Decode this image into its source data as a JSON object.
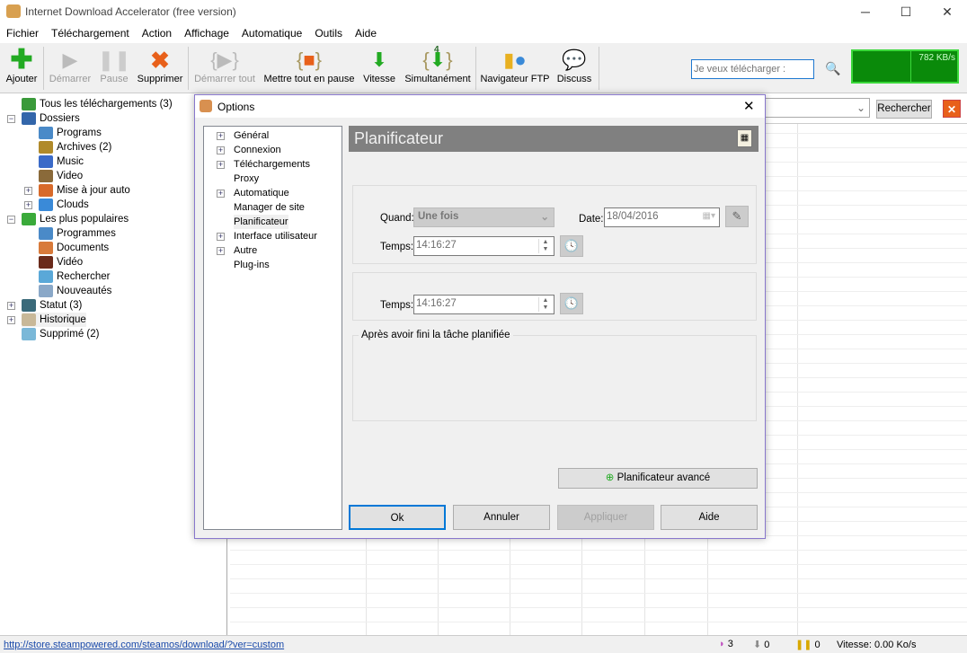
{
  "window": {
    "title": "Internet Download Accelerator (free version)",
    "minimize": "─",
    "maximize": "☐",
    "close": "✕"
  },
  "menu": [
    "Fichier",
    "Téléchargement",
    "Action",
    "Affichage",
    "Automatique",
    "Outils",
    "Aide"
  ],
  "toolbar": {
    "buttons": [
      {
        "label": "Ajouter",
        "icon": "add-icon",
        "enabled": true
      },
      {
        "label": "Démarrer",
        "icon": "play-icon",
        "enabled": false
      },
      {
        "label": "Pause",
        "icon": "pause-icon",
        "enabled": false
      },
      {
        "label": "Supprimer",
        "icon": "delete-icon",
        "enabled": true
      },
      {
        "label": "Démarrer tout",
        "icon": "start-all-icon",
        "enabled": false
      },
      {
        "label": "Mettre tout en pause",
        "icon": "pause-all-icon",
        "enabled": true
      },
      {
        "label": "Vitesse",
        "icon": "speed-icon",
        "enabled": true
      },
      {
        "label": "Simultanément",
        "icon": "simultaneous-icon",
        "enabled": true,
        "badge": "4"
      },
      {
        "label": "Navigateur FTP",
        "icon": "ftp-icon",
        "enabled": true
      },
      {
        "label": "Discuss",
        "icon": "chat-icon",
        "enabled": true
      }
    ],
    "search_placeholder": "Je veux télécharger :",
    "speed_graph": "782 KB/s"
  },
  "tree": [
    {
      "label": "Tous les téléchargements (3)",
      "color": "#3a9a3a"
    },
    {
      "label": "Dossiers",
      "color": "#3366aa"
    },
    {
      "label": "Programs",
      "color": "#4a8ac8"
    },
    {
      "label": "Archives (2)",
      "color": "#b08a2a"
    },
    {
      "label": "Music",
      "color": "#3a6ac8"
    },
    {
      "label": "Video",
      "color": "#8a6a3a"
    },
    {
      "label": "Mise à jour auto",
      "color": "#d86a2a"
    },
    {
      "label": "Clouds",
      "color": "#3a8ad8"
    },
    {
      "label": "Les plus populaires",
      "color": "#3aaa3a"
    },
    {
      "label": "Programmes",
      "color": "#4a8ac8"
    },
    {
      "label": "Documents",
      "color": "#d87a3a"
    },
    {
      "label": "Vidéo",
      "color": "#6a2a1a"
    },
    {
      "label": "Rechercher",
      "color": "#5aa8d8"
    },
    {
      "label": "Nouveautés",
      "color": "#8aa8c8"
    },
    {
      "label": "Statut (3)",
      "color": "#3a6a7a"
    },
    {
      "label": "Historique",
      "color": "#c8b898"
    },
    {
      "label": "Supprimé (2)",
      "color": "#7ab8d8"
    }
  ],
  "main": {
    "search_button": "Rechercher"
  },
  "dialog": {
    "title": "Options",
    "close": "✕",
    "nav": [
      "Général",
      "Connexion",
      "Téléchargements",
      "Proxy",
      "Automatique",
      "Manager de site",
      "Planificateur",
      "Interface utilisateur",
      "Autre",
      "Plug-ins"
    ],
    "header": "Planificateur",
    "quand_label": "Quand:",
    "quand_value": "Une fois",
    "date_label": "Date:",
    "date_value": "18/04/2016",
    "temps_label": "Temps:",
    "temps_value1": "14:16:27",
    "temps_value2": "14:16:27",
    "after_group": "Après avoir fini la tâche planifiée",
    "advanced": "Planificateur avancé",
    "ok": "Ok",
    "cancel": "Annuler",
    "apply": "Appliquer",
    "help": "Aide"
  },
  "status": {
    "url": "http://store.steampowered.com/steamos/download/?ver=custom",
    "active": "3",
    "downloading": "0",
    "paused": "0",
    "speed": "Vitesse: 0.00 Ko/s"
  }
}
